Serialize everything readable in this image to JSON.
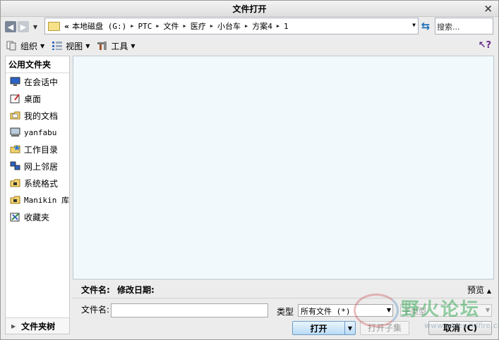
{
  "window": {
    "title": "文件打开",
    "close_glyph": "×"
  },
  "nav": {
    "back_icon": "arrow-left-icon",
    "forward_icon": "arrow-right-icon",
    "path_prefix": "«",
    "path": [
      "本地磁盘 (G:)",
      "PTC",
      "文件",
      "医疗",
      "小台车",
      "方案4",
      "1"
    ],
    "search_placeholder": "搜索..."
  },
  "toolbar": {
    "organize": "组织",
    "view": "视图",
    "tools": "工具"
  },
  "sidebar": {
    "header": "公用文件夹",
    "items": [
      {
        "label": "在会话中",
        "icon": "monitor-icon"
      },
      {
        "label": "桌面",
        "icon": "desktop-icon"
      },
      {
        "label": "我的文档",
        "icon": "documents-folder-icon"
      },
      {
        "label": "yanfabu",
        "icon": "computer-icon"
      },
      {
        "label": "工作目录",
        "icon": "work-folder-icon"
      },
      {
        "label": "网上邻居",
        "icon": "network-icon"
      },
      {
        "label": "系统格式",
        "icon": "system-folder-icon"
      },
      {
        "label": "Manikin 库",
        "icon": "library-folder-icon"
      },
      {
        "label": "收藏夹",
        "icon": "favorites-icon"
      }
    ],
    "tree_label": "文件夹树"
  },
  "details": {
    "filename_col": "文件名:",
    "date_col": "修改日期:",
    "preview": "预览"
  },
  "form": {
    "filename_label": "文件名:",
    "filename_value": "",
    "type_label": "类型",
    "type_value": "所有文件 (*)",
    "subtype_value": "子类型"
  },
  "buttons": {
    "open": "打开",
    "open_subset": "打开子集",
    "cancel": "取消 (C)"
  },
  "watermark": {
    "brand": "野火论坛",
    "url": "www.proewildfire.cn"
  },
  "colors": {
    "file_pane_bg": "#f2f9fc",
    "open_button": "#b9dbf6"
  }
}
